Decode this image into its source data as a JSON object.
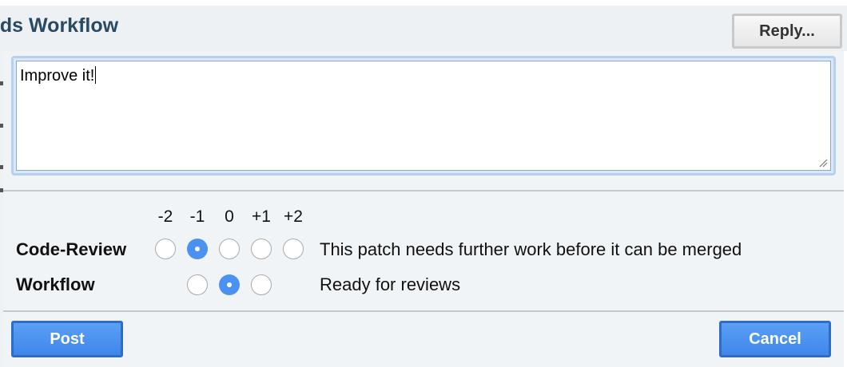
{
  "page": {
    "title": "eds Workflow",
    "reply_label": "Reply..."
  },
  "editor": {
    "text": "Improve it!"
  },
  "scores": [
    "-2",
    "-1",
    "0",
    "+1",
    "+2"
  ],
  "labels": [
    {
      "name": "Code-Review",
      "selected": "-1",
      "description": "This patch needs further work before it can be merged"
    },
    {
      "name": "Workflow",
      "selected": "0",
      "description": "Ready for reviews"
    }
  ],
  "actions": {
    "post_label": "Post",
    "cancel_label": "Cancel"
  },
  "colors": {
    "accent": "#4b92f0",
    "title": "#2a4a63",
    "dialog_bg": "#f1f4f6"
  }
}
